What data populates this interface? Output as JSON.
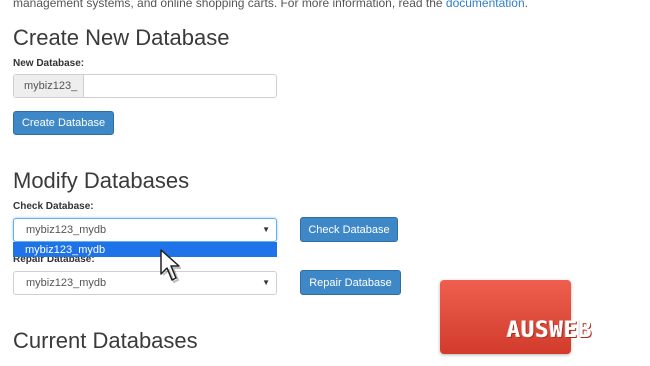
{
  "intro": {
    "text": "management systems, and online shopping carts. For more information, read the ",
    "link": "documentation",
    "end": "."
  },
  "create": {
    "title": "Create New Database",
    "label": "New Database:",
    "prefix": "mybiz123_",
    "value": "",
    "button": "Create Database"
  },
  "modify": {
    "title": "Modify Databases",
    "check_label": "Check Database:",
    "check_value": "mybiz123_mydb",
    "check_button": "Check Database",
    "dropdown_option": "mybiz123_mydb",
    "repair_label": "Repair Database:",
    "repair_value": "mybiz123_mydb",
    "repair_button": "Repair Database"
  },
  "current": {
    "title": "Current Databases"
  },
  "watermark": {
    "text": "AUSWEB"
  },
  "colors": {
    "button": "#3f88c8",
    "highlight": "#1e73e8",
    "logo": "#e44c3c"
  }
}
